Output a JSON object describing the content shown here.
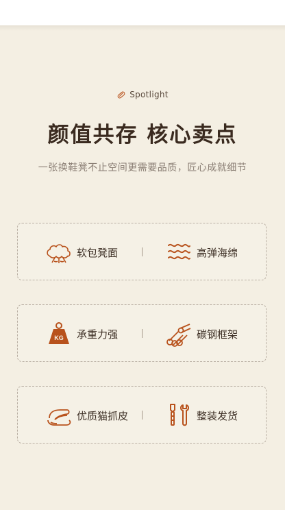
{
  "header": {
    "spotlight": "Spotlight",
    "title": "颜值共存 核心卖点",
    "subtitle": "一张换鞋凳不止空间更需要品质，匠心成就细节"
  },
  "colors": {
    "accent": "#b8521c",
    "background": "#f4efe3",
    "title": "#3a2a1f"
  },
  "features": [
    {
      "left": {
        "icon": "cotton-icon",
        "label": "软包凳面"
      },
      "right": {
        "icon": "waves-icon",
        "label": "高弹海绵"
      }
    },
    {
      "left": {
        "icon": "weight-icon",
        "label": "承重力强"
      },
      "right": {
        "icon": "tubes-icon",
        "label": "碳钢框架"
      }
    },
    {
      "left": {
        "icon": "leather-icon",
        "label": "优质猫抓皮"
      },
      "right": {
        "icon": "tools-icon",
        "label": "整装发货"
      }
    }
  ],
  "weight_icon_text": "KG"
}
